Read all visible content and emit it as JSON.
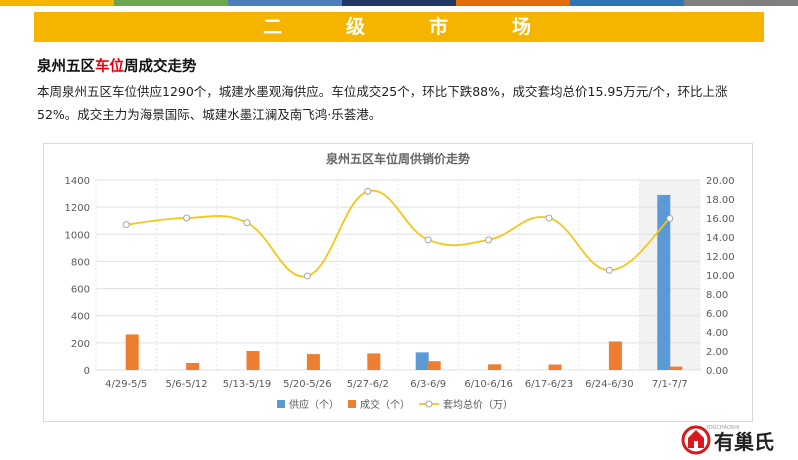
{
  "header": {
    "stripe_colors": [
      "#f5b400",
      "#6aa84f",
      "#4a7ebb",
      "#1f3864",
      "#e46c0a",
      "#2e75b6",
      "#7f7f7f"
    ],
    "banner_chars": [
      "二",
      "级",
      "市",
      "场"
    ]
  },
  "section": {
    "title_prefix": "泉州五区",
    "title_highlight": "车位",
    "title_suffix": "周成交走势",
    "paragraph": "本周泉州五区车位供应1290个，城建水墨观海供应。车位成交25个，环比下跌88%，成交套均总价15.95万元/个，环比上涨52%。成交主力为海景国际、城建水墨江澜及南飞鸿·乐荟港。"
  },
  "logo": {
    "text": "有巢氏",
    "tagline": "YOUCHAOSHI"
  },
  "chart_data": {
    "type": "bar",
    "title": "泉州五区车位周供销价走势",
    "categories": [
      "4/29-5/5",
      "5/6-5/12",
      "5/13-5/19",
      "5/20-5/26",
      "5/27-6/2",
      "6/3-6/9",
      "6/10-6/16",
      "6/17-6/23",
      "6/24-6/30",
      "7/1-7/7"
    ],
    "series": [
      {
        "name": "供应（个）",
        "kind": "bar",
        "axis": "left",
        "color": "#5b9bd5",
        "values": [
          0,
          0,
          0,
          0,
          0,
          130,
          0,
          0,
          0,
          1290
        ]
      },
      {
        "name": "成交（个）",
        "kind": "bar",
        "axis": "left",
        "color": "#ed7d31",
        "values": [
          262,
          52,
          140,
          117,
          122,
          65,
          42,
          40,
          210,
          25
        ]
      },
      {
        "name": "套均总价（万）",
        "kind": "line",
        "axis": "right",
        "color": "#f5c518",
        "values": [
          15.3,
          16.0,
          15.5,
          9.9,
          18.8,
          13.7,
          13.7,
          16.0,
          10.5,
          15.95
        ]
      }
    ],
    "y_left": {
      "min": 0,
      "max": 1400,
      "step": 200,
      "tick_labels": [
        "0",
        "200",
        "400",
        "600",
        "800",
        "1000",
        "1200",
        "1400"
      ]
    },
    "y_right": {
      "min": 0,
      "max": 20,
      "step": 2,
      "tick_labels": [
        "0.00",
        "2.00",
        "4.00",
        "6.00",
        "8.00",
        "10.00",
        "12.00",
        "14.00",
        "16.00",
        "18.00",
        "20.00"
      ]
    },
    "highlight_category": "7/1-7/7",
    "grid": true,
    "legend_position": "bottom"
  }
}
